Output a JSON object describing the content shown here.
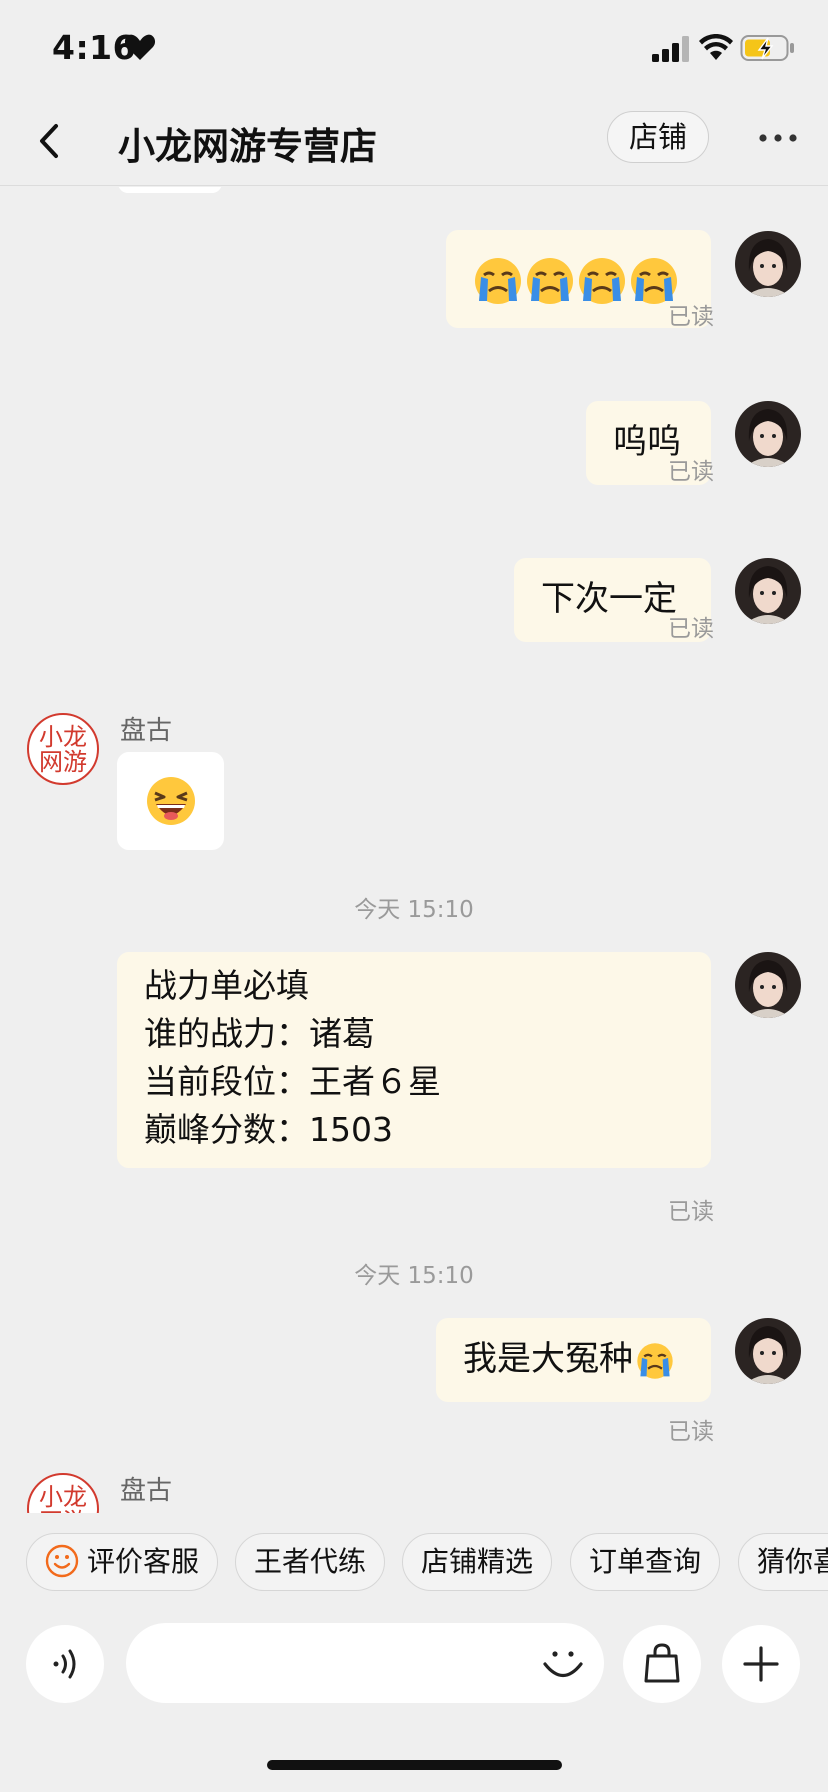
{
  "status": {
    "time": "4:16"
  },
  "header": {
    "title": "小龙网游专营店",
    "store_label": "店铺"
  },
  "messages": {
    "read_label": "已读",
    "m2_text": "呜呜",
    "m3_text": "下次一定",
    "sender_name": "盘古",
    "timestamp1": "今天 15:10",
    "form": {
      "line1": "战力单必填",
      "line2": "谁的战力：诸葛",
      "line3": "当前段位：王者６星",
      "line4": "巅峰分数：1503"
    },
    "timestamp2": "今天 15:10",
    "m6_text": "我是大冤种"
  },
  "shop_avatar_text": "小龙网游",
  "shortcuts": [
    "评价客服",
    "王者代练",
    "店铺精选",
    "订单查询",
    "猜你喜欢"
  ],
  "input": {
    "placeholder": ""
  },
  "colors": {
    "my_bubble": "#fdf8e8",
    "their_bubble": "#ffffff",
    "background": "#efefef",
    "seal_red": "#d23a2e"
  }
}
